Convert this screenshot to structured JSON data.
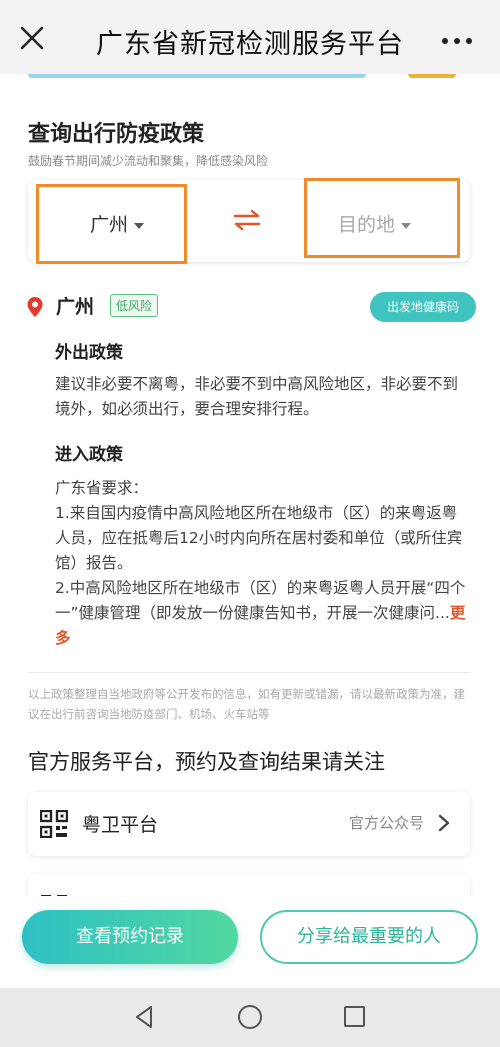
{
  "header": {
    "title": "广东省新冠检测服务平台"
  },
  "query": {
    "title": "查询出行防疫政策",
    "subtitle": "鼓励春节期间减少流动和聚集，降低感染风险",
    "from": "广州",
    "to_placeholder": "目的地",
    "highlight_color": "#f08a2a"
  },
  "location": {
    "city": "广州",
    "risk": "低风险",
    "risk_color": "#3aa85a",
    "health_code_button": "出发地健康码"
  },
  "policy": {
    "out_title": "外出政策",
    "out_text": "建议非必要不离粤，非必要不到中高风险地区，非必要不到境外，如必须出行，要合理安排行程。",
    "in_title": "进入政策",
    "in_lines": [
      "广东省要求：",
      "1.来自国内疫情中高风险地区所在地级市（区）的来粤返粤人员，应在抵粤后12小时内向所在居村委和单位（或所住宾馆）报告。",
      "2.中高风险地区所在地级市（区）的来粤返粤人员开展“四个一”健康管理（即发放一份健康告知书，开展一次健康问..."
    ],
    "more_link": "更多"
  },
  "disclaimer": "以上政策整理自当地政府等公开发布的信息，如有更新或错漏，请以最新政策为准，建议在出行前咨询当地防疫部门、机场、火车站等",
  "services": {
    "title": "官方服务平台，预约及查询结果请关注",
    "items": [
      {
        "name": "粤卫平台",
        "tag": "官方公众号"
      }
    ]
  },
  "actions": {
    "primary": "查看预约记录",
    "secondary": "分享给最重要的人",
    "accent_color": "#2ec0c4"
  }
}
